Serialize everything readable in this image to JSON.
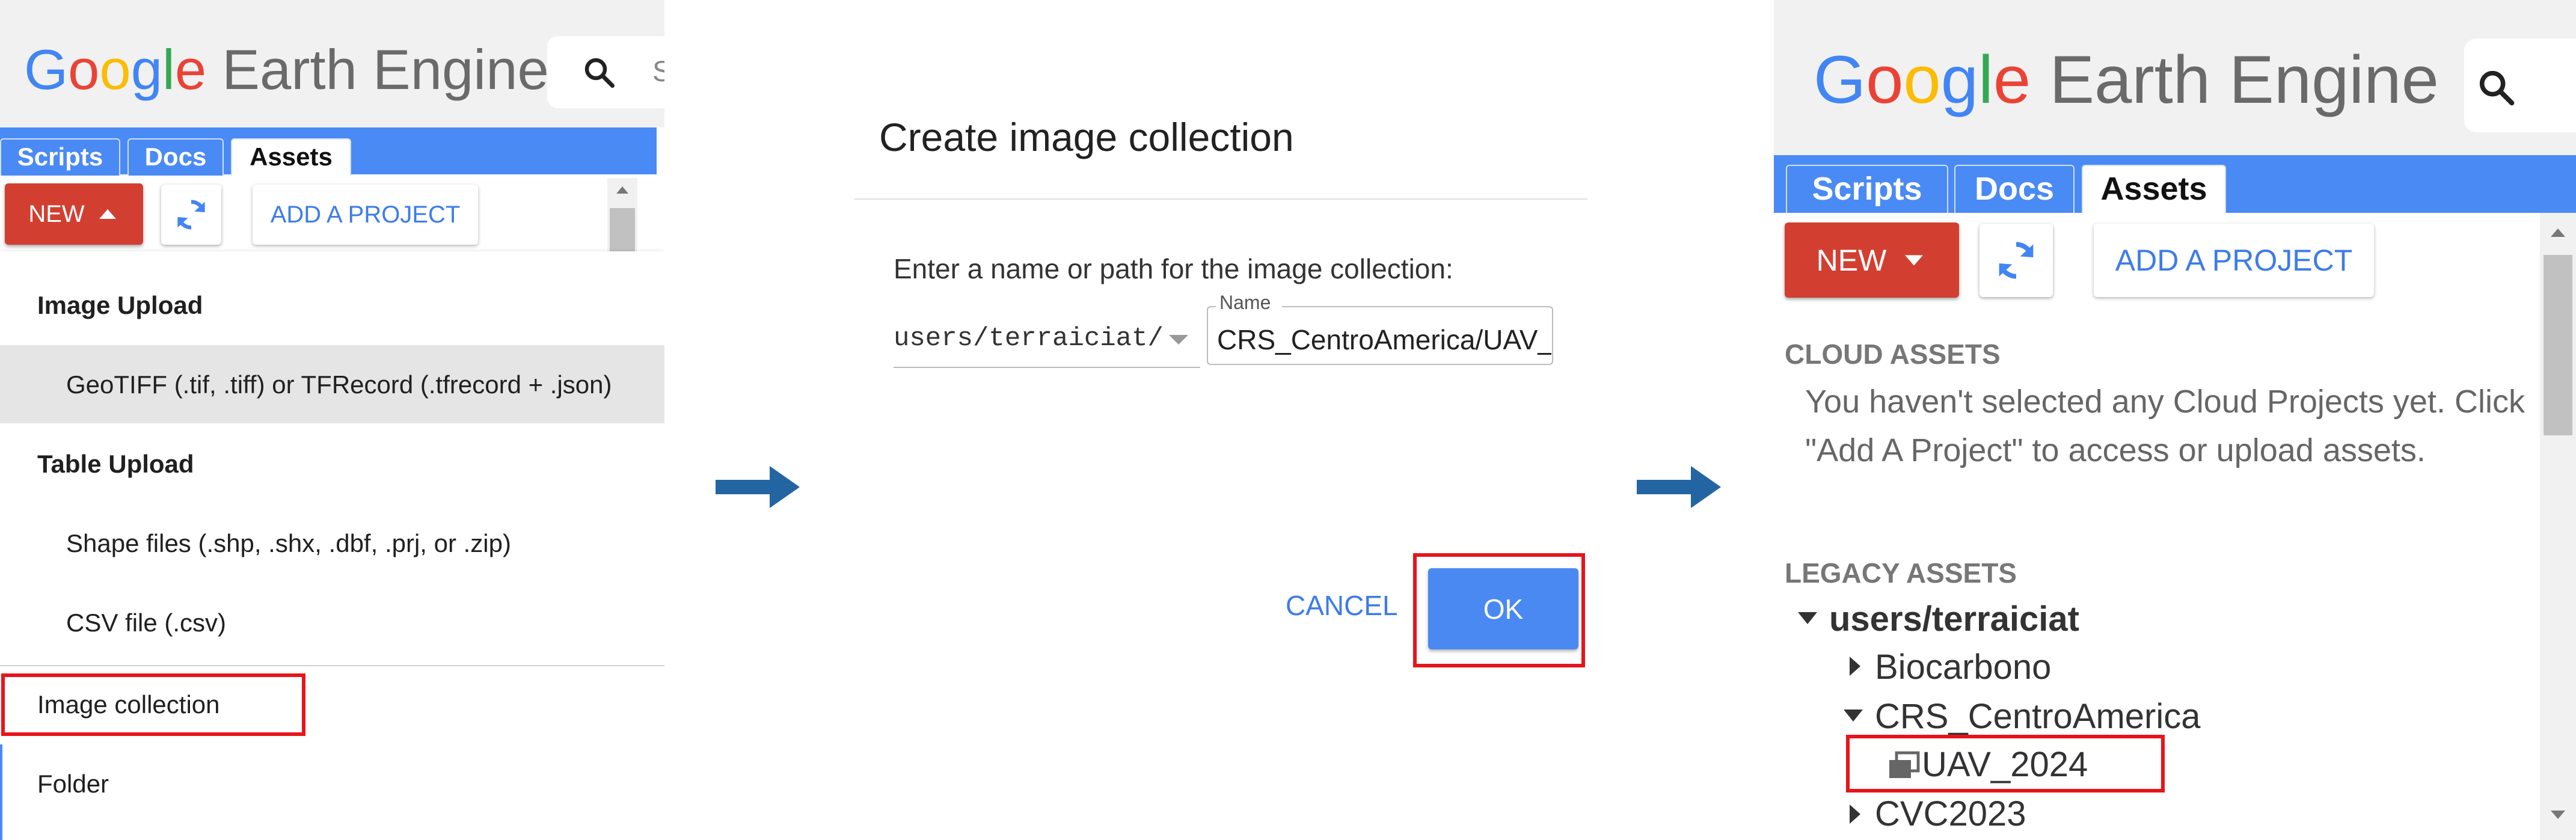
{
  "panel1": {
    "logo": {
      "google": "Google",
      "product": "Earth Engine"
    },
    "search_glyph": "S",
    "tabs": [
      "Scripts",
      "Docs",
      "Assets"
    ],
    "active_tab": "Assets",
    "new_button": "NEW",
    "add_project_button": "ADD A PROJECT",
    "menu": {
      "image_upload_header": "Image Upload",
      "geotiff_item": "GeoTIFF (.tif, .tiff) or TFRecord (.tfrecord + .json)",
      "table_upload_header": "Table Upload",
      "shape_item": "Shape files (.shp, .shx, .dbf, .prj, or .zip)",
      "csv_item": "CSV file (.csv)",
      "image_collection_item": "Image collection",
      "folder_item": "Folder"
    }
  },
  "panel2": {
    "title": "Create image collection",
    "prompt": "Enter a name or path for the image collection:",
    "path_prefix": "users/terraiciat/",
    "name_label": "Name",
    "name_value": "CRS_CentroAmerica/UAV_",
    "cancel_button": "CANCEL",
    "ok_button": "OK"
  },
  "panel3": {
    "logo": {
      "google": "Google",
      "product": "Earth Engine"
    },
    "tabs": [
      "Scripts",
      "Docs",
      "Assets"
    ],
    "active_tab": "Assets",
    "new_button": "NEW",
    "add_project_button": "ADD A PROJECT",
    "cloud_assets_header": "CLOUD ASSETS",
    "cloud_assets_message": "You haven't selected any Cloud Projects yet. Click \"Add A Project\" to access or upload assets.",
    "legacy_assets_header": "LEGACY ASSETS",
    "tree": {
      "root": "users/terraiciat",
      "children": [
        "Biocarbono",
        "CRS_CentroAmerica",
        "CVC2023"
      ],
      "expanded_child": "CRS_CentroAmerica",
      "new_collection": "UAV_2024"
    }
  },
  "colors": {
    "tab_blue": "#4a8af4",
    "new_red": "#d23f31",
    "highlight_red": "#e8141b",
    "arrow_blue": "#2365a3",
    "ok_blue": "#4a89f2",
    "link_blue": "#3d7ce8"
  }
}
